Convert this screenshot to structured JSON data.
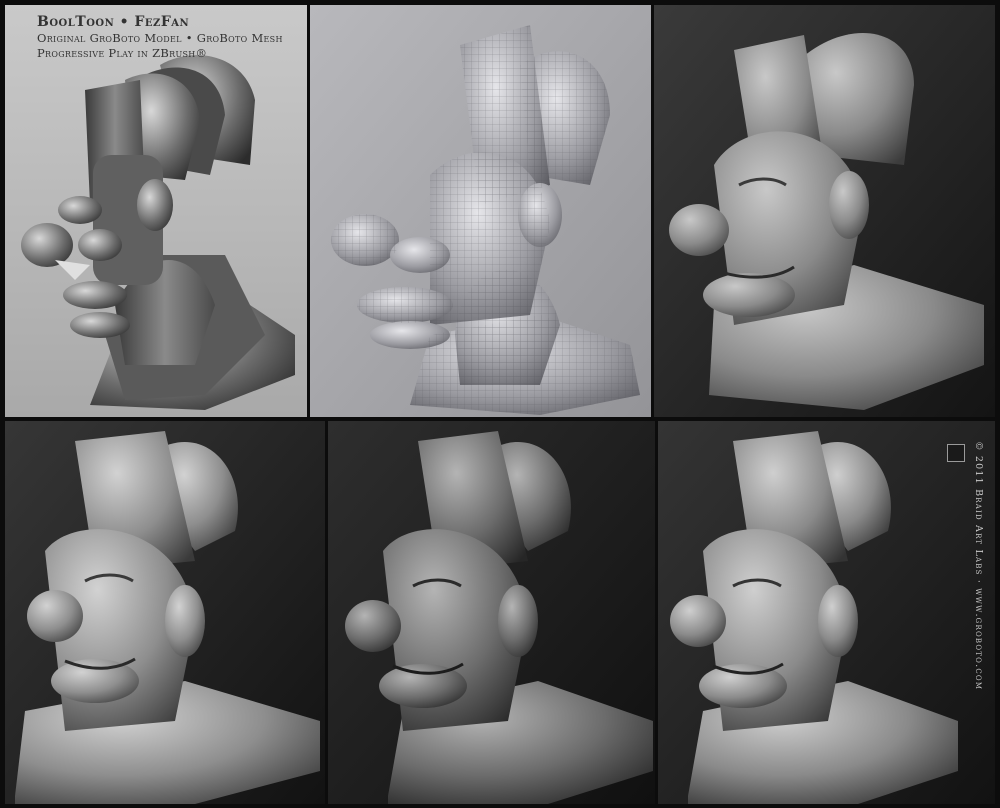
{
  "caption": {
    "title": "BoolToon • FezFan",
    "line1": "Original GroBoto Model • GroBoto Mesh",
    "line2": "Progressive Play in ZBrush®"
  },
  "credit": "© 2011  Braid Art Labs · www.groboto.com",
  "panels": [
    {
      "name": "groboto-model",
      "style": "flat"
    },
    {
      "name": "groboto-mesh",
      "style": "wireframe"
    },
    {
      "name": "zbrush-stage-1",
      "style": "sculpt"
    },
    {
      "name": "zbrush-stage-2",
      "style": "sculpt"
    },
    {
      "name": "zbrush-stage-3",
      "style": "sculpt-dark"
    },
    {
      "name": "zbrush-stage-4",
      "style": "sculpt"
    }
  ],
  "colors": {
    "panel1_bg": "#b5b5b5",
    "panel2_bg": "#a4a4a8",
    "dark_bg": "#242424",
    "clay": "#8c8c8c"
  }
}
